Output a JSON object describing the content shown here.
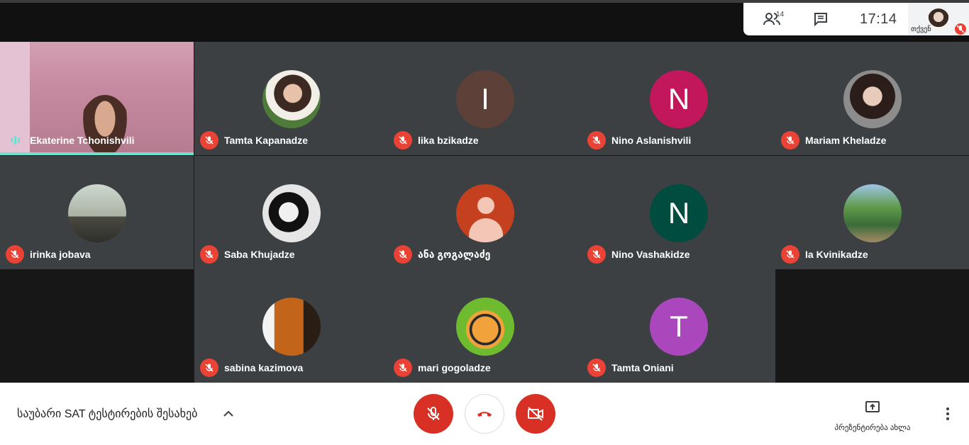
{
  "app": {
    "participants_count": "14",
    "clock": "17:14",
    "self_label": "თქვენ"
  },
  "tiles": [
    {
      "name": "Ekaterine Tchonishvili",
      "speaking": true
    },
    {
      "name": "Tamta Kapanadze",
      "avatar": "photo1"
    },
    {
      "name": "lika bzikadze",
      "initial": "I",
      "color": "#5d4037"
    },
    {
      "name": "Nino Aslanishvili",
      "initial": "N",
      "color": "#c2185b"
    },
    {
      "name": "Mariam Kheladze",
      "avatar": "photo2"
    },
    {
      "name": "irinka jobava",
      "avatar": "photo3"
    },
    {
      "name": "Saba Khujadze",
      "avatar": "photo4"
    },
    {
      "name": "ანა გოგალაძე",
      "avatar": "generic",
      "color": "#c5401f"
    },
    {
      "name": "Nino Vashakidze",
      "initial": "N",
      "color": "#004d40"
    },
    {
      "name": "Ia Kvinikadze",
      "avatar": "photo5"
    },
    {
      "name": "sabina kazimova",
      "avatar": "photo6"
    },
    {
      "name": "mari gogoladze",
      "avatar": "bee"
    },
    {
      "name": "Tamta Oniani",
      "initial": "T",
      "color": "#ab47bc"
    }
  ],
  "bottom": {
    "meeting_title": "საუბარი SAT ტესტირების შესახებ",
    "present_label": "პრეზენტირება ახლა"
  },
  "icons": {
    "people": "people-icon",
    "chat": "chat-icon",
    "mic_off": "mic-off-icon",
    "hangup": "phone-hangup-icon",
    "cam_off": "camera-off-icon",
    "present": "present-screen-icon",
    "more": "more-vert-icon",
    "chevron": "chevron-up-icon"
  },
  "colors": {
    "danger": "#d93025",
    "speaking": "#6de2cf",
    "tile_bg": "#3c4043"
  }
}
